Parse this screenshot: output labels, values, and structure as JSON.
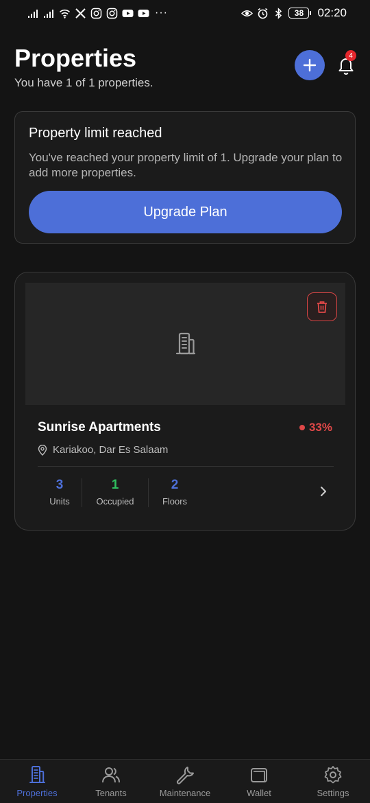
{
  "status_bar": {
    "time": "02:20",
    "battery": "38",
    "left_icons": [
      "signal-icon",
      "signal-icon",
      "wifi-icon",
      "x-app-icon",
      "instagram-icon",
      "instagram-icon",
      "youtube-icon",
      "youtube-icon"
    ],
    "overflow": "···",
    "right_icons": [
      "eye-icon",
      "alarm-icon",
      "bluetooth-icon"
    ]
  },
  "header": {
    "title": "Properties",
    "subtitle": "You have 1 of 1 properties.",
    "notification_count": "4",
    "accent_color": "#4d6fd8"
  },
  "limit_card": {
    "title": "Property limit reached",
    "message": "You've reached your property limit of 1. Upgrade your plan to add more properties.",
    "button_label": "Upgrade Plan"
  },
  "property": {
    "name": "Sunrise Apartments",
    "occupancy": "33%",
    "occupancy_color": "#e04848",
    "location": "Kariakoo, Dar Es Salaam",
    "stats": [
      {
        "value": "3",
        "label": "Units",
        "color": "#4d6fd8"
      },
      {
        "value": "1",
        "label": "Occupied",
        "color": "#2fbf5f"
      },
      {
        "value": "2",
        "label": "Floors",
        "color": "#4d6fd8"
      }
    ]
  },
  "nav": {
    "active": "Properties",
    "items": [
      {
        "label": "Properties",
        "icon": "building-icon"
      },
      {
        "label": "Tenants",
        "icon": "users-icon"
      },
      {
        "label": "Maintenance",
        "icon": "wrench-icon"
      },
      {
        "label": "Wallet",
        "icon": "wallet-icon"
      },
      {
        "label": "Settings",
        "icon": "gear-icon"
      }
    ]
  }
}
